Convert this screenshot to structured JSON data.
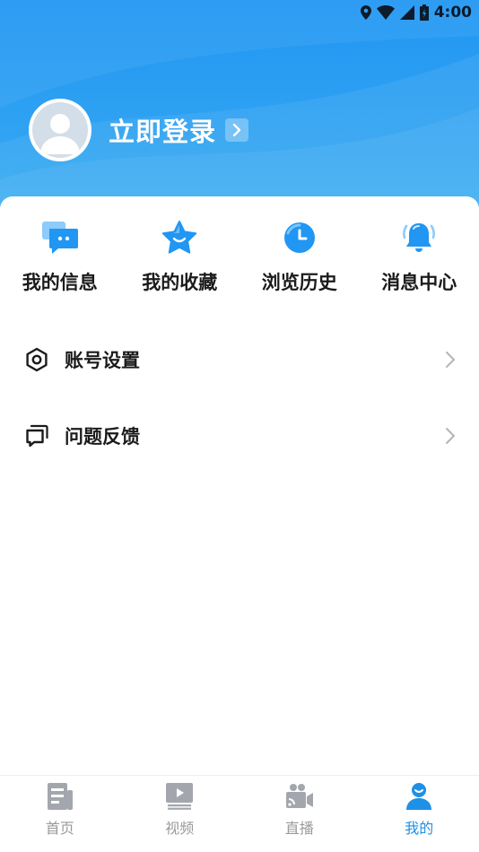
{
  "status_bar": {
    "time": "4:00",
    "icons": [
      "location-icon",
      "wifi-icon",
      "signal-icon",
      "battery-icon"
    ]
  },
  "profile": {
    "login_label": "立即登录",
    "avatar_icon": "default-avatar-icon",
    "arrow_icon": "chevron-right-icon"
  },
  "quick_actions": [
    {
      "label": "我的信息",
      "icon": "chat-bubbles-icon"
    },
    {
      "label": "我的收藏",
      "icon": "star-icon"
    },
    {
      "label": "浏览历史",
      "icon": "clock-icon"
    },
    {
      "label": "消息中心",
      "icon": "bell-icon"
    }
  ],
  "menu": [
    {
      "label": "账号设置",
      "icon": "hexagon-settings-icon"
    },
    {
      "label": "问题反馈",
      "icon": "feedback-icon"
    }
  ],
  "tabs": [
    {
      "label": "首页",
      "icon": "news-icon",
      "active": false
    },
    {
      "label": "视频",
      "icon": "video-icon",
      "active": false
    },
    {
      "label": "直播",
      "icon": "live-camera-icon",
      "active": false
    },
    {
      "label": "我的",
      "icon": "user-icon",
      "active": true
    }
  ],
  "colors": {
    "header_blue": "#2196F3",
    "accent": "#1E90E6",
    "inactive_tab": "#9a9a9a"
  }
}
